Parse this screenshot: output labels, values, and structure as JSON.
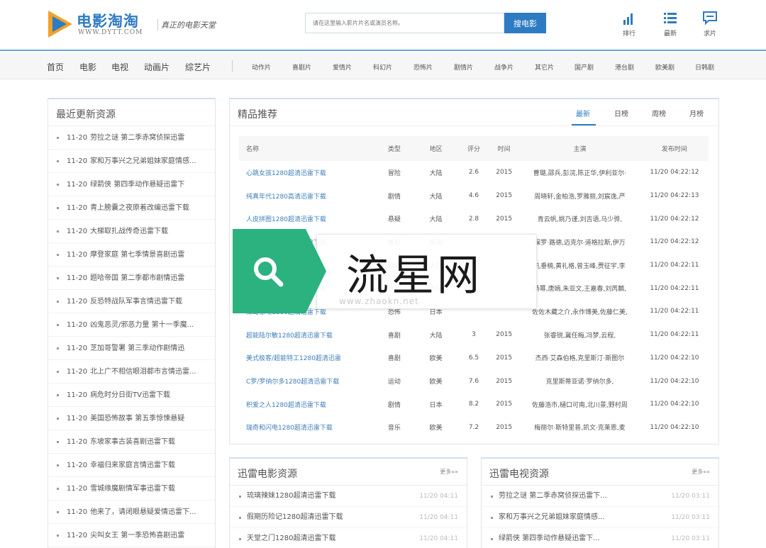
{
  "header": {
    "logo_title": "电影淘淘",
    "logo_url": "WWW.DYTT.COM",
    "slogan": "真正的电影天堂",
    "search_placeholder": "请在这里输入影片片名或演员名称。",
    "search_button": "搜电影",
    "links": [
      {
        "label": "排行",
        "icon": "bar-chart-icon"
      },
      {
        "label": "最新",
        "icon": "list-icon"
      },
      {
        "label": "求片",
        "icon": "chat-icon"
      }
    ],
    "colors": {
      "brand": "#2d7bc3",
      "accent_green": "#2bb27f",
      "logo_orange": "#f0a12a"
    }
  },
  "nav": {
    "main": [
      "首页",
      "电影",
      "电视",
      "动画片",
      "综艺片"
    ],
    "sub": [
      "动作片",
      "喜剧片",
      "爱情片",
      "科幻片",
      "恐怖片",
      "剧情片",
      "战争片",
      "其它片",
      "国产剧",
      "港台剧",
      "欧美剧",
      "日韩剧"
    ]
  },
  "recent": {
    "title": "最近更新资源",
    "items": [
      {
        "date": "11-20",
        "text": "劳拉之谜 第二季赤窝侦探迅雷"
      },
      {
        "date": "11-20",
        "text": "家和万事兴之兄弟姐妹家庭情感..."
      },
      {
        "date": "11-20",
        "text": "绿箭侠 第四季动作悬疑迅雷下"
      },
      {
        "date": "11-20",
        "text": "青上膀囊之夜原着改编迅雷下载"
      },
      {
        "date": "11-20",
        "text": "大梯取扎战传奇迅雷下载"
      },
      {
        "date": "11-20",
        "text": "摩登家庭 第七季情景喜剧迅雷"
      },
      {
        "date": "11-20",
        "text": "题哈帝国 第二季都市剧情迅雷"
      },
      {
        "date": "11-20",
        "text": "反恐特战队军事言情迅雷下载"
      },
      {
        "date": "11-20",
        "text": "凶鬼恶灵/邪恶力量 第十一季魔..."
      },
      {
        "date": "11-20",
        "text": "芝加哥警署 第三季动作剧情迅"
      },
      {
        "date": "11-20",
        "text": "北上广不相信眼泪都市言情迅雷..."
      },
      {
        "date": "11-20",
        "text": "病危时分日街TV迅雷下载"
      },
      {
        "date": "11-20",
        "text": "美国恐怖故事 第五季惊悚悬疑"
      },
      {
        "date": "11-20",
        "text": "东坡家事古装喜剧迅雷下载"
      },
      {
        "date": "11-20",
        "text": "幸福归来家庭言情迅雷下载"
      },
      {
        "date": "11-20",
        "text": "雪城缘魔剧情军事迅雷下载"
      },
      {
        "date": "11-20",
        "text": "他来了，请闭眼悬疑爱情迅雷下..."
      },
      {
        "date": "11-20",
        "text": "尖叫女王 第一季恐怖喜剧迅雷"
      }
    ]
  },
  "featured": {
    "title": "精品推荐",
    "tabs": [
      "最新",
      "日榜",
      "周榜",
      "月榜"
    ],
    "columns": [
      "名称",
      "类型",
      "地区",
      "评分",
      "时间",
      "主演",
      "发布时间"
    ],
    "rows": [
      {
        "name": "心跳女孩1280超清迅雷下载",
        "type": "冒险",
        "region": "大陆",
        "score": "2.6",
        "year": "2015",
        "cast": "曹璐,邵兵,彭浣,陈正华,伊利亚尔·",
        "time": "11/20 04:22:12"
      },
      {
        "name": "纯真年代1280高清迅雷下载",
        "type": "剧情",
        "region": "大陆",
        "score": "4.6",
        "year": "2015",
        "cast": "周晓轩,金柏浩,罗雅丽,刘宸逸,严",
        "time": "11/20 04:22:13"
      },
      {
        "name": "人皮拼图1280超清迅雷下载",
        "type": "悬疑",
        "region": "大陆",
        "score": "2.8",
        "year": "2015",
        "cast": "青云帆,姚乃谨,刘吉语,马少骅,",
        "time": "11/20 04:22:12"
      },
      {
        "name": "我的女神1280超清迅雷下载",
        "type": "喜剧",
        "region": "美国",
        "score": "",
        "year": "",
        "cast": "保罗·路德,迈克尔·道格拉斯,伊万",
        "time": "11/20 04:22:12"
      },
      {
        "name": "夏日谎言1280超清迅雷下载",
        "type": "剧情",
        "region": "大陆",
        "score": "",
        "year": "",
        "cast": "孔垂楠,黄礼格,曾玉峰,贾征宇,李",
        "time": "11/20 04:22:11"
      },
      {
        "name": "一路惊喜1280超清迅雷下载",
        "type": "喜剧",
        "region": "大陆",
        "score": "",
        "year": "",
        "cast": "杨幂,唐嫣,朱亚文,王嘉春,刘芮麟,",
        "time": "11/20 04:22:11"
      },
      {
        "name": "孤岛惊魂1280超清迅雷下载",
        "type": "恐怖",
        "region": "日本",
        "score": "",
        "year": "",
        "cast": "佐佐木藏之介,永作博美,佐藤仁美,",
        "time": "11/20 04:22:11"
      },
      {
        "name": "超能陆尔敏1280超清迅雷下载",
        "type": "喜剧",
        "region": "大陆",
        "score": "3",
        "year": "2015",
        "cast": "张睿锐,冀任梅,冯梦,云程,",
        "time": "11/20 04:22:11"
      },
      {
        "name": "美式极客/超能特工1280超清迅雷",
        "type": "喜剧",
        "region": "欧美",
        "score": "6.5",
        "year": "2015",
        "cast": "杰西·艾森伯格,克里斯汀·斯图尔",
        "time": "11/20 04:22:10"
      },
      {
        "name": "C罗/罗纳尔多1280超清迅雷下载",
        "type": "运动",
        "region": "欧美",
        "score": "7.6",
        "year": "2015",
        "cast": "克里斯蒂亚诺·罗纳尔多,",
        "time": "11/20 04:22:10"
      },
      {
        "name": "积爱之人1280超清迅雷下载",
        "type": "剧情",
        "region": "日本",
        "score": "8.2",
        "year": "2015",
        "cast": "佐藤浩市,樋口可南,北川景,野村周",
        "time": "11/20 04:22:10"
      },
      {
        "name": "瑞奇和闪电1280超清迅雷下载",
        "type": "音乐",
        "region": "欧美",
        "score": "7.2",
        "year": "2015",
        "cast": "梅丽尔·斯特里普,凯文·克莱恩,麦",
        "time": "11/20 04:22:10"
      }
    ]
  },
  "movies_panel": {
    "title": "迅雷电影资源",
    "more": "更多»»",
    "items": [
      {
        "text": "琉璃辣妹1280超清迅雷下载",
        "date": "11/20 04:11"
      },
      {
        "text": "假期历险记1280超清迅雷下载",
        "date": "11/20 04:11"
      },
      {
        "text": "天堂之门1280超清迅雷下载",
        "date": "11/20 04:11"
      }
    ]
  },
  "tv_panel": {
    "title": "迅雷电视资源",
    "more": "更多»»",
    "items": [
      {
        "text": "劳拉之谜 第二季赤窝侦探迅雷下...",
        "date": "11/20 03:11"
      },
      {
        "text": "家和万事兴之兄弟姐妹家庭情感...",
        "date": "11/20 03:11"
      },
      {
        "text": "绿箭侠 第四季动作悬疑迅雷下...",
        "date": "11/20 03:11"
      }
    ]
  },
  "watermark": {
    "text": "流星网",
    "url": "www.zhaokn.net"
  }
}
